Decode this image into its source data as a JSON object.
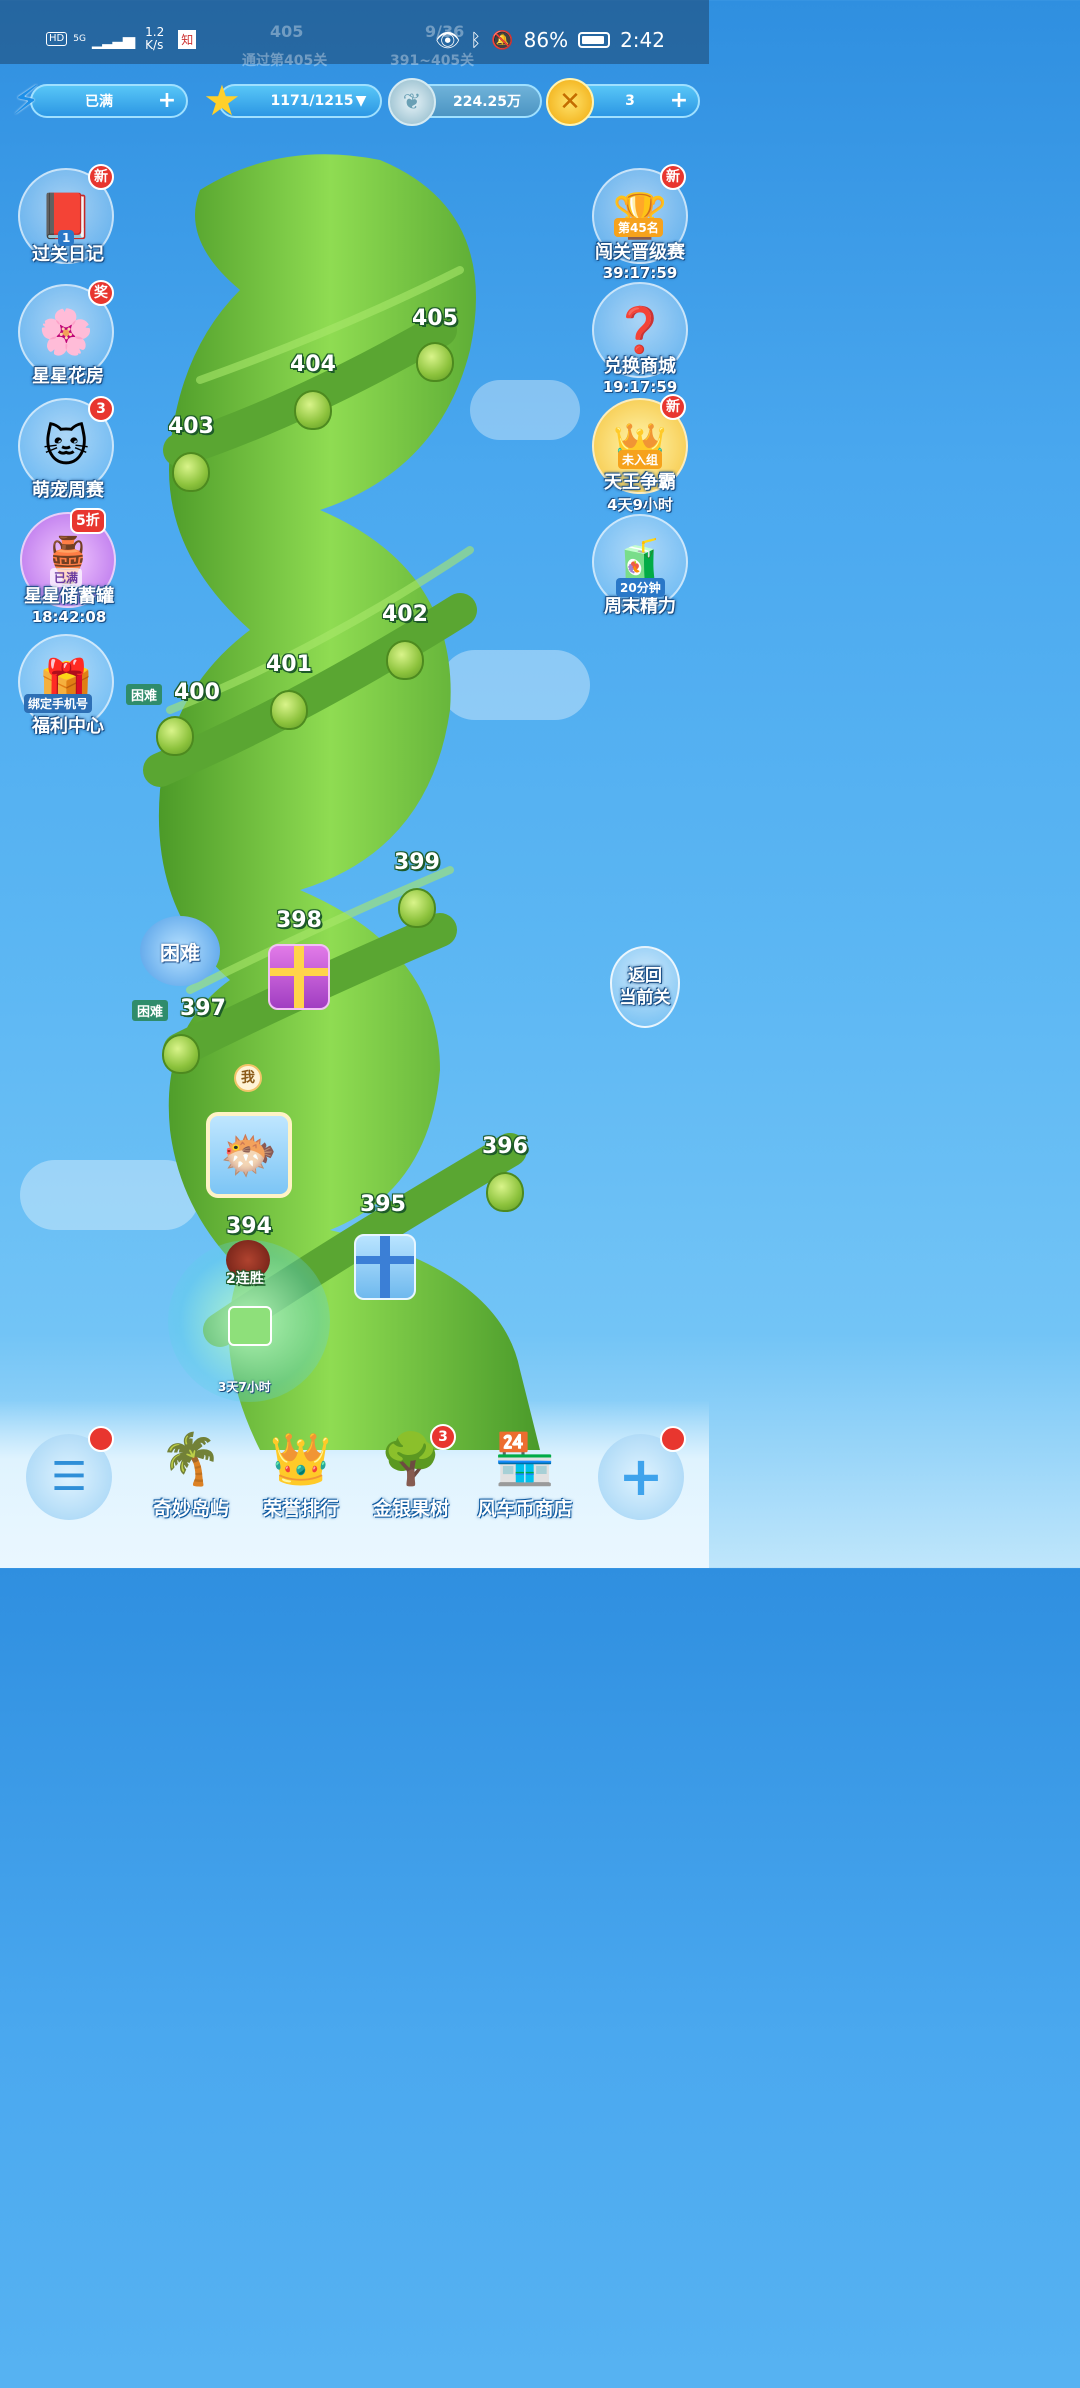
{
  "status_bar": {
    "network_label": "HD",
    "signal_label": "5G",
    "speed_value": "1.2",
    "speed_unit": "K/s",
    "app_badge": "知",
    "battery_percent": "86%",
    "time": "2:42",
    "battery_level": 0.86
  },
  "top_faded": {
    "current_level": "405",
    "passed_label": "通过第405关",
    "star_progress": "9/36",
    "range_label": "391~405关"
  },
  "resources": {
    "energy": "已满",
    "stars": "1171/1215",
    "coins": "224.25万",
    "tokens": "3"
  },
  "left_menu": [
    {
      "label": "过关日记",
      "badge": "新",
      "tag": "1",
      "icon": "diary-icon"
    },
    {
      "label": "星星花房",
      "badge": "奖",
      "icon": "flower-icon"
    },
    {
      "label": "萌宠周赛",
      "badge": "3",
      "icon": "cat-icon"
    },
    {
      "label": "星星储蓄罐",
      "badge": "5折",
      "tag": "已满",
      "time": "18:42:08",
      "icon": "piggybank-icon"
    },
    {
      "label": "福利中心",
      "tag": "绑定手机号",
      "icon": "gift-box-icon"
    }
  ],
  "right_menu": [
    {
      "label": "闯关晋级赛",
      "badge": "新",
      "tag": "第45名",
      "time": "39:17:59",
      "icon": "trophy-icon"
    },
    {
      "label": "兑换商城",
      "time": "19:17:59",
      "icon": "mystery-box-icon"
    },
    {
      "label": "天王争霸",
      "badge": "新",
      "tag": "未入组",
      "time": "4天9小时",
      "icon": "crown-icon"
    },
    {
      "label": "周末精力",
      "tag": "20分钟",
      "icon": "energy-drink-icon"
    }
  ],
  "levels": {
    "l405": "405",
    "l404": "404",
    "l403": "403",
    "l402": "402",
    "l401": "401",
    "l400": "400",
    "l399": "399",
    "l398": "398",
    "l397": "397",
    "l396": "396",
    "l395": "395",
    "l394": "394",
    "hard_label": "困难",
    "hard_flower_label": "困难",
    "me_label": "我",
    "streak_label": "2连胜",
    "bonus_timer": "3天7小时"
  },
  "return_button": "返回\n当前关",
  "bottom_nav": [
    {
      "label": "奇妙岛屿",
      "icon": "palm-island-icon"
    },
    {
      "label": "荣誉排行",
      "icon": "crown-rank-icon"
    },
    {
      "label": "金银果树",
      "badge": "3",
      "icon": "fruit-tree-icon"
    },
    {
      "label": "风车币商店",
      "icon": "shop-icon"
    }
  ],
  "colors": {
    "sky": "#4aa8ef",
    "vine": "#6fc23a",
    "badge_red": "#e8362f"
  }
}
